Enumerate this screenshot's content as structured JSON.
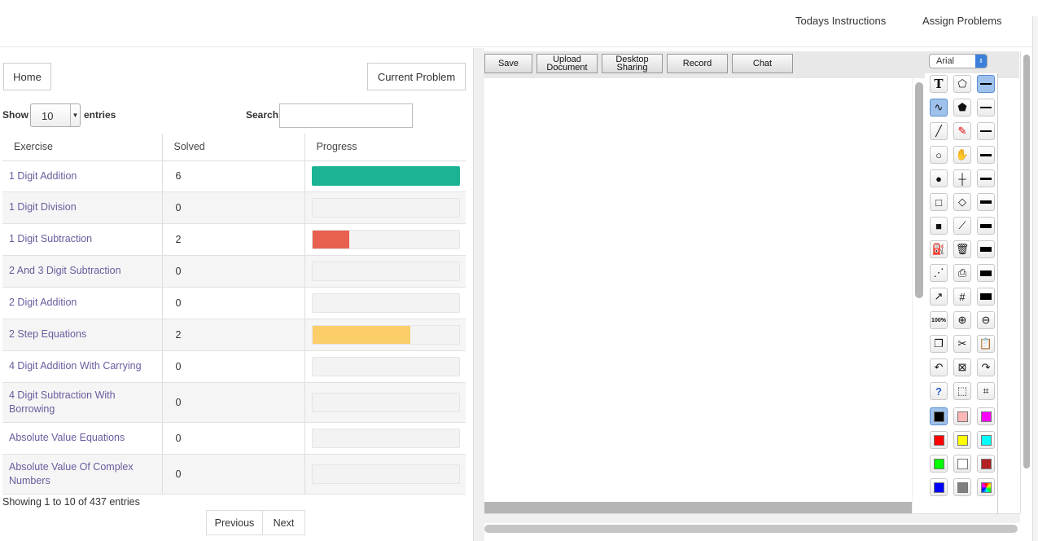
{
  "topnav": {
    "instructions": "Todays Instructions",
    "assign": "Assign Problems"
  },
  "left": {
    "home": "Home",
    "current_problem": "Current Problem",
    "show_label": "Show",
    "entries_value": "10",
    "entries_label": "entries",
    "search_label": "Search:",
    "search_value": "",
    "columns": [
      "Exercise",
      "Solved",
      "Progress"
    ],
    "rows": [
      {
        "exercise": "1 Digit Addition",
        "solved": "6",
        "progress": 1.0,
        "color": "#1bb394"
      },
      {
        "exercise": "1 Digit Division",
        "solved": "0",
        "progress": 0,
        "color": "#1bb394"
      },
      {
        "exercise": "1 Digit Subtraction",
        "solved": "2",
        "progress": 0.25,
        "color": "#e8604f"
      },
      {
        "exercise": "2 And 3 Digit Subtraction",
        "solved": "0",
        "progress": 0,
        "color": "#1bb394"
      },
      {
        "exercise": "2 Digit Addition",
        "solved": "0",
        "progress": 0,
        "color": "#1bb394"
      },
      {
        "exercise": "2 Step Equations",
        "solved": "2",
        "progress": 0.67,
        "color": "#fcce6a"
      },
      {
        "exercise": "4 Digit Addition With Carrying",
        "solved": "0",
        "progress": 0,
        "color": "#1bb394"
      },
      {
        "exercise": "4 Digit Subtraction With Borrowing",
        "solved": "0",
        "progress": 0,
        "color": "#1bb394"
      },
      {
        "exercise": "Absolute Value Equations",
        "solved": "0",
        "progress": 0,
        "color": "#1bb394"
      },
      {
        "exercise": "Absolute Value Of Complex Numbers",
        "solved": "0",
        "progress": 0,
        "color": "#1bb394"
      }
    ],
    "showing": "Showing 1 to 10 of 437 entries",
    "previous": "Previous",
    "next": "Next"
  },
  "whiteboard": {
    "save": "Save",
    "upload": "Upload Document",
    "desktop": "Desktop Sharing",
    "record": "Record",
    "chat": "Chat",
    "font": "Arial",
    "tool_icons": [
      "text-icon",
      "pentagon-outline-icon",
      "line-weight-1-icon",
      "curve-icon",
      "pentagon-filled-icon",
      "line-weight-2-icon",
      "line-icon",
      "marker-icon",
      "line-weight-3-icon",
      "circle-outline-icon",
      "hand-icon",
      "line-weight-4-icon",
      "circle-filled-icon",
      "crosshair-icon",
      "line-weight-5-icon",
      "rectangle-outline-icon",
      "eraser-icon",
      "line-weight-6-icon",
      "rectangle-filled-icon",
      "eyedropper-icon",
      "line-weight-7-icon",
      "paint-bucket-icon",
      "trash-icon",
      "line-weight-8-icon",
      "dotted-line-icon",
      "printer-icon",
      "line-weight-9-icon",
      "arrow-icon",
      "grid-icon",
      "line-weight-10-icon",
      "zoom-100-icon",
      "zoom-in-icon",
      "zoom-out-icon",
      "copy-icon",
      "cut-icon",
      "paste-icon",
      "undo-icon",
      "clear-icon",
      "redo-icon",
      "help-icon",
      "select-icon",
      "crop-icon"
    ],
    "zoom_label": "100%",
    "colors": [
      "#000000",
      "#ffb6b6",
      "#ff00ff",
      "#ff0000",
      "#ffff00",
      "#00ffff",
      "#00ff00",
      "#ffffff",
      "#b22222",
      "#0000ff",
      "#808080",
      "multicolor"
    ]
  }
}
